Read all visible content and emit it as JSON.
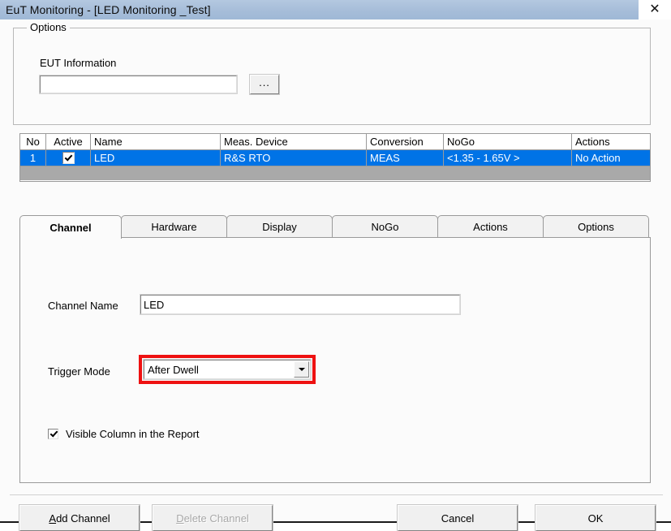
{
  "window": {
    "title": "EuT Monitoring  -  [LED Monitoring _Test]",
    "close_icon": "close-icon",
    "close_glyph": "✕"
  },
  "options_group": {
    "legend": "Options",
    "eut_information": {
      "label": "EUT Information",
      "value": "",
      "placeholder": "",
      "browse_label": "..."
    }
  },
  "grid": {
    "columns": [
      "No",
      "Active",
      "Name",
      "Meas. Device",
      "Conversion",
      "NoGo",
      "Actions"
    ],
    "rows": [
      {
        "no": "1",
        "active": true,
        "name": "LED",
        "meas_device": "R&S RTO",
        "conversion": "MEAS",
        "nogo": "<1.35 - 1.65V >",
        "actions": "No Action",
        "selected": true
      }
    ]
  },
  "tabs": [
    {
      "label": "Channel",
      "active": true
    },
    {
      "label": "Hardware",
      "active": false
    },
    {
      "label": "Display",
      "active": false
    },
    {
      "label": "NoGo",
      "active": false
    },
    {
      "label": "Actions",
      "active": false
    },
    {
      "label": "Options",
      "active": false
    }
  ],
  "channel_tab": {
    "channel_name": {
      "label": "Channel Name",
      "value": "LED",
      "placeholder": ""
    },
    "trigger_mode": {
      "label": "Trigger Mode",
      "value": "After Dwell",
      "options": [
        "After Dwell"
      ],
      "highlight_color": "#ee1111"
    },
    "visible_column": {
      "label": "Visible Column in the Report",
      "checked": true
    }
  },
  "buttons": {
    "add_channel": {
      "accel": "A",
      "rest": "dd Channel",
      "enabled": true
    },
    "delete_channel": {
      "accel": "D",
      "rest": "elete Channel",
      "enabled": false
    },
    "cancel": {
      "label": "Cancel",
      "enabled": true
    },
    "ok": {
      "label": "OK",
      "enabled": true
    }
  },
  "colors": {
    "titlebar": "#a6bdd9",
    "selection": "#0073e6",
    "annotation": "#ee1111"
  }
}
